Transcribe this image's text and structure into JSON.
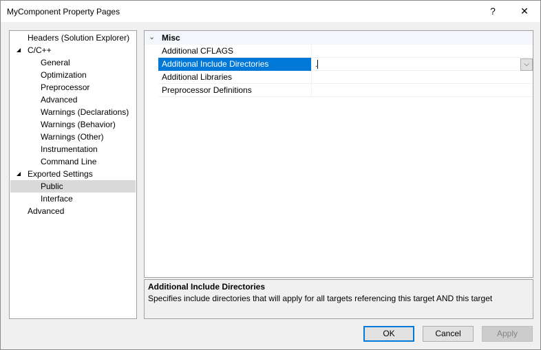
{
  "window": {
    "title": "MyComponent Property Pages",
    "help": "?",
    "close": "✕"
  },
  "tree": [
    {
      "label": "Headers (Solution Explorer)",
      "level": 0,
      "expander": ""
    },
    {
      "label": "C/C++",
      "level": 0,
      "expander": "◢"
    },
    {
      "label": "General",
      "level": 1
    },
    {
      "label": "Optimization",
      "level": 1
    },
    {
      "label": "Preprocessor",
      "level": 1
    },
    {
      "label": "Advanced",
      "level": 1
    },
    {
      "label": "Warnings (Declarations)",
      "level": 1
    },
    {
      "label": "Warnings (Behavior)",
      "level": 1
    },
    {
      "label": "Warnings (Other)",
      "level": 1
    },
    {
      "label": "Instrumentation",
      "level": 1
    },
    {
      "label": "Command Line",
      "level": 1
    },
    {
      "label": "Exported Settings",
      "level": 0,
      "expander": "◢"
    },
    {
      "label": "Public",
      "level": 1,
      "selected": true
    },
    {
      "label": "Interface",
      "level": 1
    },
    {
      "label": "Advanced",
      "level": 0
    }
  ],
  "grid": {
    "category": "Misc",
    "properties": [
      {
        "name": "Additional CFLAGS",
        "value": ""
      },
      {
        "name": "Additional Include Directories",
        "value": ".",
        "selected": true
      },
      {
        "name": "Additional Libraries",
        "value": ""
      },
      {
        "name": "Preprocessor Definitions",
        "value": ""
      }
    ]
  },
  "description": {
    "title": "Additional Include Directories",
    "text": "Specifies include directories that will apply for all targets referencing this target AND this target"
  },
  "buttons": {
    "ok": "OK",
    "cancel": "Cancel",
    "apply": "Apply"
  },
  "colors": {
    "selection": "#0078d7"
  }
}
